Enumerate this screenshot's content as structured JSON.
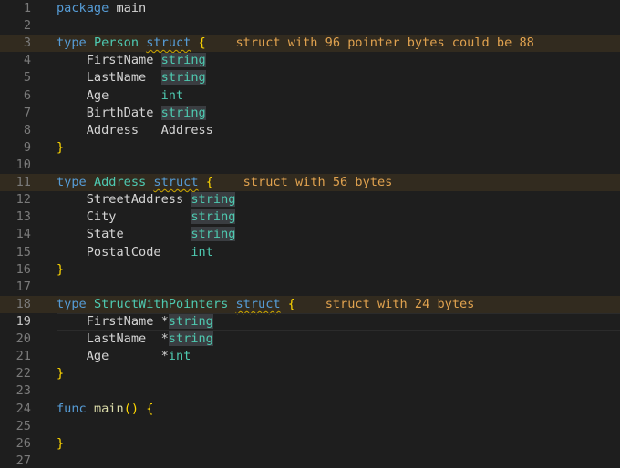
{
  "editor": {
    "active_line": "19",
    "lines": [
      {
        "n": "1",
        "t": [
          {
            "k": "kw",
            "v": "package"
          },
          {
            "k": "tx",
            "v": " main"
          }
        ]
      },
      {
        "n": "2",
        "t": []
      },
      {
        "n": "3",
        "hl": true,
        "t": [
          {
            "k": "kw",
            "v": "type"
          },
          {
            "k": "tx",
            "v": " "
          },
          {
            "k": "ty",
            "v": "Person"
          },
          {
            "k": "tx",
            "v": " "
          },
          {
            "k": "kw",
            "v": "struct",
            "sq": true
          },
          {
            "k": "tx",
            "v": " "
          },
          {
            "k": "br",
            "v": "{"
          },
          {
            "k": "tx",
            "v": "    "
          },
          {
            "k": "hint",
            "v": "struct with 96 pointer bytes could be 88"
          }
        ]
      },
      {
        "n": "4",
        "t": [
          {
            "k": "tx",
            "v": "    FirstName "
          },
          {
            "k": "ty",
            "v": "string",
            "sel": true
          }
        ]
      },
      {
        "n": "5",
        "t": [
          {
            "k": "tx",
            "v": "    LastName  "
          },
          {
            "k": "ty",
            "v": "string",
            "sel": true
          }
        ]
      },
      {
        "n": "6",
        "t": [
          {
            "k": "tx",
            "v": "    Age       "
          },
          {
            "k": "ty",
            "v": "int"
          }
        ]
      },
      {
        "n": "7",
        "t": [
          {
            "k": "tx",
            "v": "    BirthDate "
          },
          {
            "k": "ty",
            "v": "string",
            "sel": true
          }
        ]
      },
      {
        "n": "8",
        "t": [
          {
            "k": "tx",
            "v": "    Address   Address"
          }
        ]
      },
      {
        "n": "9",
        "t": [
          {
            "k": "br",
            "v": "}"
          }
        ]
      },
      {
        "n": "10",
        "t": []
      },
      {
        "n": "11",
        "hl": true,
        "t": [
          {
            "k": "kw",
            "v": "type"
          },
          {
            "k": "tx",
            "v": " "
          },
          {
            "k": "ty",
            "v": "Address"
          },
          {
            "k": "tx",
            "v": " "
          },
          {
            "k": "kw",
            "v": "struct",
            "sq": true
          },
          {
            "k": "tx",
            "v": " "
          },
          {
            "k": "br",
            "v": "{"
          },
          {
            "k": "tx",
            "v": "    "
          },
          {
            "k": "hint",
            "v": "struct with 56 bytes"
          }
        ]
      },
      {
        "n": "12",
        "t": [
          {
            "k": "tx",
            "v": "    StreetAddress "
          },
          {
            "k": "ty",
            "v": "string",
            "sel": true
          }
        ]
      },
      {
        "n": "13",
        "t": [
          {
            "k": "tx",
            "v": "    City          "
          },
          {
            "k": "ty",
            "v": "string",
            "sel": true
          }
        ]
      },
      {
        "n": "14",
        "t": [
          {
            "k": "tx",
            "v": "    State         "
          },
          {
            "k": "ty",
            "v": "string",
            "sel": true
          }
        ]
      },
      {
        "n": "15",
        "t": [
          {
            "k": "tx",
            "v": "    PostalCode    "
          },
          {
            "k": "ty",
            "v": "int"
          }
        ]
      },
      {
        "n": "16",
        "t": [
          {
            "k": "br",
            "v": "}"
          }
        ]
      },
      {
        "n": "17",
        "t": []
      },
      {
        "n": "18",
        "hl": true,
        "t": [
          {
            "k": "kw",
            "v": "type"
          },
          {
            "k": "tx",
            "v": " "
          },
          {
            "k": "ty",
            "v": "StructWithPointers"
          },
          {
            "k": "tx",
            "v": " "
          },
          {
            "k": "kw",
            "v": "struct",
            "sq": true
          },
          {
            "k": "tx",
            "v": " "
          },
          {
            "k": "br",
            "v": "{"
          },
          {
            "k": "tx",
            "v": "    "
          },
          {
            "k": "hint",
            "v": "struct with 24 bytes"
          }
        ]
      },
      {
        "n": "19",
        "t": [
          {
            "k": "tx",
            "v": "    FirstName *"
          },
          {
            "k": "ty",
            "v": "string",
            "sel": true
          }
        ]
      },
      {
        "n": "20",
        "t": [
          {
            "k": "tx",
            "v": "    LastName  *"
          },
          {
            "k": "ty",
            "v": "string",
            "sel": true
          }
        ]
      },
      {
        "n": "21",
        "t": [
          {
            "k": "tx",
            "v": "    Age       *"
          },
          {
            "k": "ty",
            "v": "int"
          }
        ]
      },
      {
        "n": "22",
        "t": [
          {
            "k": "br",
            "v": "}"
          }
        ]
      },
      {
        "n": "23",
        "t": []
      },
      {
        "n": "24",
        "t": [
          {
            "k": "kw",
            "v": "func"
          },
          {
            "k": "tx",
            "v": " "
          },
          {
            "k": "fn",
            "v": "main"
          },
          {
            "k": "br",
            "v": "()"
          },
          {
            "k": "tx",
            "v": " "
          },
          {
            "k": "br",
            "v": "{"
          }
        ]
      },
      {
        "n": "25",
        "t": []
      },
      {
        "n": "26",
        "t": [
          {
            "k": "br",
            "v": "}"
          }
        ]
      },
      {
        "n": "27",
        "t": []
      }
    ]
  }
}
